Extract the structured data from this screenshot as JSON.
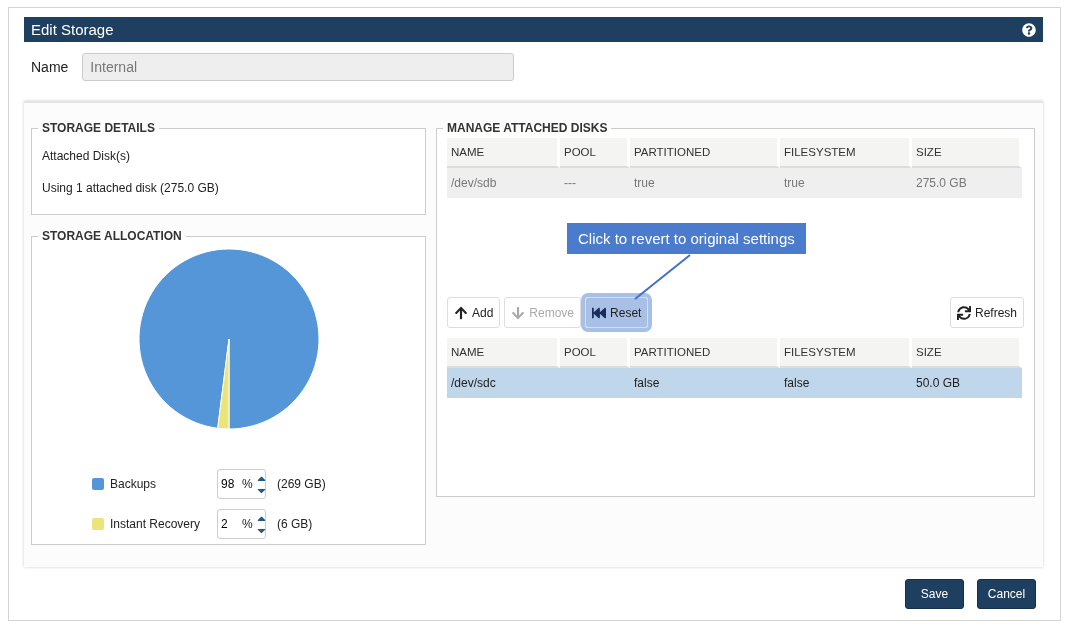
{
  "window": {
    "title": "Edit Storage"
  },
  "name_field": {
    "label": "Name",
    "value": "Internal",
    "disabled": true
  },
  "storage_details": {
    "title": "STORAGE DETAILS",
    "lines": [
      "Attached Disk(s)",
      "Using 1 attached disk (275.0 GB)"
    ]
  },
  "storage_allocation": {
    "title": "STORAGE ALLOCATION",
    "chart_data": {
      "type": "pie",
      "values": [
        98,
        2
      ]
    },
    "legend": [
      {
        "label": "Backups",
        "color": "#5596d8",
        "value": "98",
        "unit": "%",
        "reading": "(269 GB)"
      },
      {
        "label": "Instant Recovery",
        "color": "#eae47a",
        "value": "2",
        "unit": "%",
        "reading": "(6 GB)"
      }
    ]
  },
  "attached_disks": {
    "title": "MANAGE ATTACHED DISKS",
    "top_table": {
      "columns": [
        "NAME",
        "POOL",
        "PARTITIONED",
        "FILESYSTEM",
        "SIZE"
      ],
      "rows": [
        {
          "cells": [
            "/dev/sdb",
            "---",
            "true",
            "true",
            "275.0 GB"
          ],
          "disabled": true,
          "selected": false
        }
      ]
    },
    "callout": "Click to revert to original settings",
    "toolbar": [
      {
        "kind": "add",
        "label": "Add",
        "disabled": false,
        "highlighted": false
      },
      {
        "kind": "remove",
        "label": "Remove",
        "disabled": true,
        "highlighted": false
      },
      {
        "kind": "reset",
        "label": "Reset",
        "disabled": false,
        "highlighted": true
      },
      {
        "kind": "refresh",
        "label": "Refresh",
        "disabled": false,
        "highlighted": false
      }
    ],
    "bottom_table": {
      "columns": [
        "NAME",
        "POOL",
        "PARTITIONED",
        "FILESYSTEM",
        "SIZE"
      ],
      "rows": [
        {
          "cells": [
            "/dev/sdc",
            "",
            "false",
            "false",
            "50.0 GB"
          ],
          "disabled": false,
          "selected": true
        }
      ]
    }
  },
  "buttons": [
    "Save",
    "Cancel"
  ]
}
